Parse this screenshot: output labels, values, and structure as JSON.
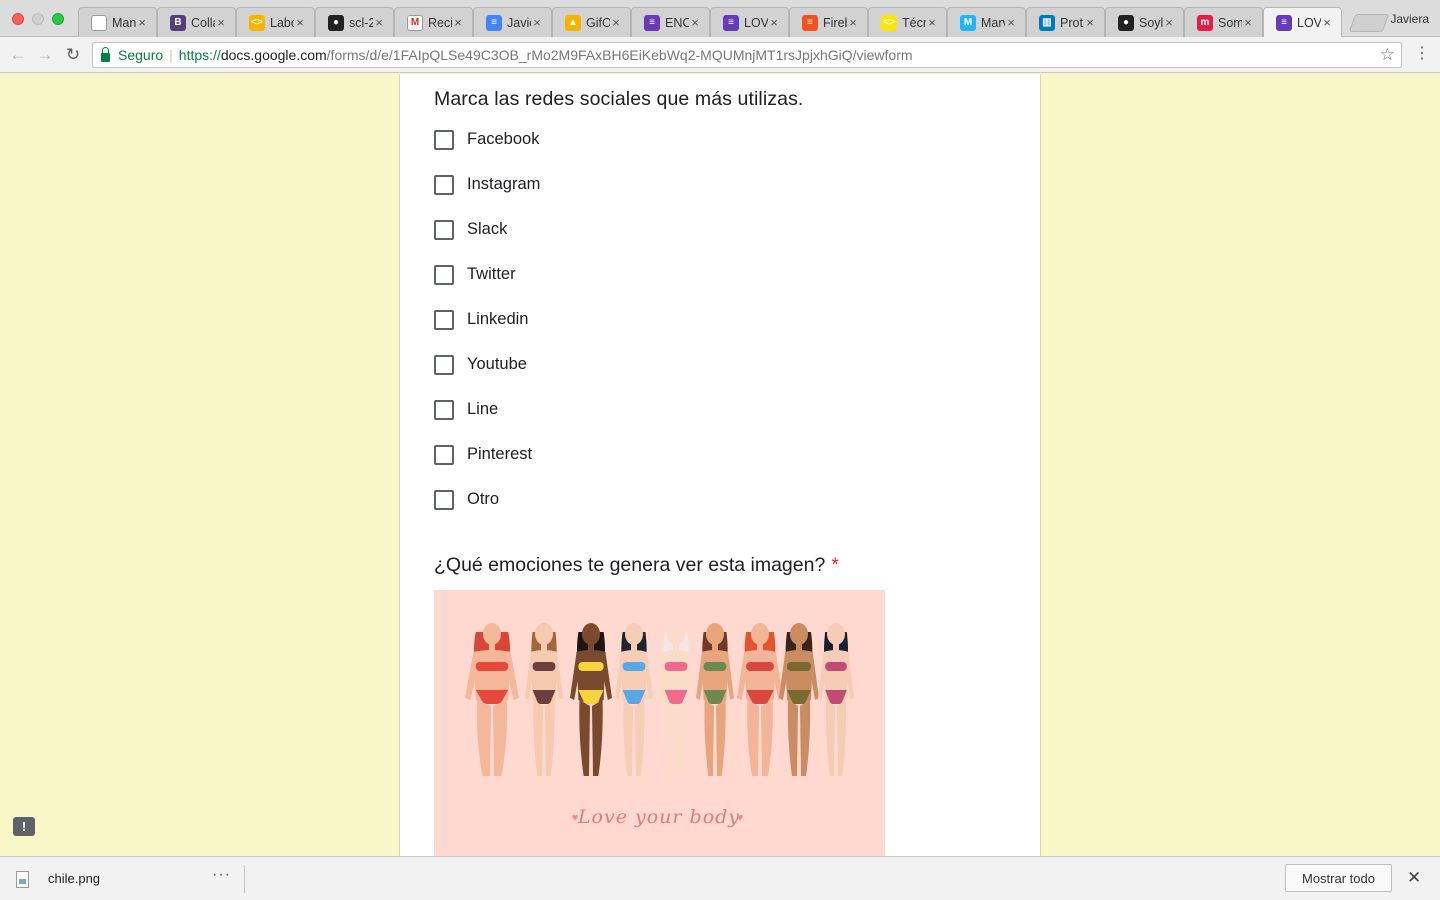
{
  "window": {
    "profile_name": "Javiera"
  },
  "tabs": [
    {
      "label": "Man",
      "icon": "document-icon",
      "color": "#ffffff",
      "glyph": ""
    },
    {
      "label": "Colla",
      "icon": "bootstrap-icon",
      "color": "#563d7c",
      "glyph": "B"
    },
    {
      "label": "Labo",
      "icon": "laboratoria-icon",
      "color": "#f7b500",
      "glyph": "<>"
    },
    {
      "label": "scl-2",
      "icon": "github-icon",
      "color": "#222222",
      "glyph": "●"
    },
    {
      "label": "Recib",
      "icon": "gmail-icon",
      "color": "#ffffff",
      "glyph": "M"
    },
    {
      "label": "Javie",
      "icon": "filter-icon",
      "color": "#4285f4",
      "glyph": "≡"
    },
    {
      "label": "GifO",
      "icon": "drive-icon",
      "color": "#f4b400",
      "glyph": "▲"
    },
    {
      "label": "ENC",
      "icon": "forms-icon",
      "color": "#673ab7",
      "glyph": "≡"
    },
    {
      "label": "LOVI",
      "icon": "forms-icon",
      "color": "#673ab7",
      "glyph": "≡"
    },
    {
      "label": "Fireb",
      "icon": "firebase-icon",
      "color": "#f4511e",
      "glyph": "≡"
    },
    {
      "label": "Técn",
      "icon": "laboratoria-icon",
      "color": "#ffe600",
      "glyph": "<>"
    },
    {
      "label": "Marv",
      "icon": "marvel-icon",
      "color": "#1fb6ff",
      "glyph": "M"
    },
    {
      "label": "Prot",
      "icon": "trello-icon",
      "color": "#0079bf",
      "glyph": "▥"
    },
    {
      "label": "Soyl",
      "icon": "github-icon",
      "color": "#222222",
      "glyph": "●"
    },
    {
      "label": "Som",
      "icon": "medium-icon",
      "color": "#e11d48",
      "glyph": "m"
    },
    {
      "label": "LOVI",
      "icon": "forms-icon",
      "color": "#673ab7",
      "glyph": "≡",
      "active": true
    }
  ],
  "address": {
    "secure_label": "Seguro",
    "scheme": "https://",
    "host": "docs.google.com",
    "path": "/forms/d/e/1FAIpQLSe49C3OB_rMo2M9FAxBH6EiKebWq2-MQUMnjMT1rsJpjxhGiQ/viewform"
  },
  "form": {
    "question1": "Marca las redes sociales que más utilizas.",
    "options": [
      "Facebook",
      "Instagram",
      "Slack",
      "Twitter",
      "Linkedin",
      "Youtube",
      "Line",
      "Pinterest",
      "Otro"
    ],
    "question2": "¿Qué emociones te genera ver esta imagen?",
    "required_mark": "*",
    "image_caption": "Love your body",
    "accent_color": "#673ab7",
    "required_color": "#d93025"
  },
  "download": {
    "filename": "chile.png",
    "more_label": "···",
    "show_all_label": "Mostrar todo",
    "close_label": "✕"
  }
}
